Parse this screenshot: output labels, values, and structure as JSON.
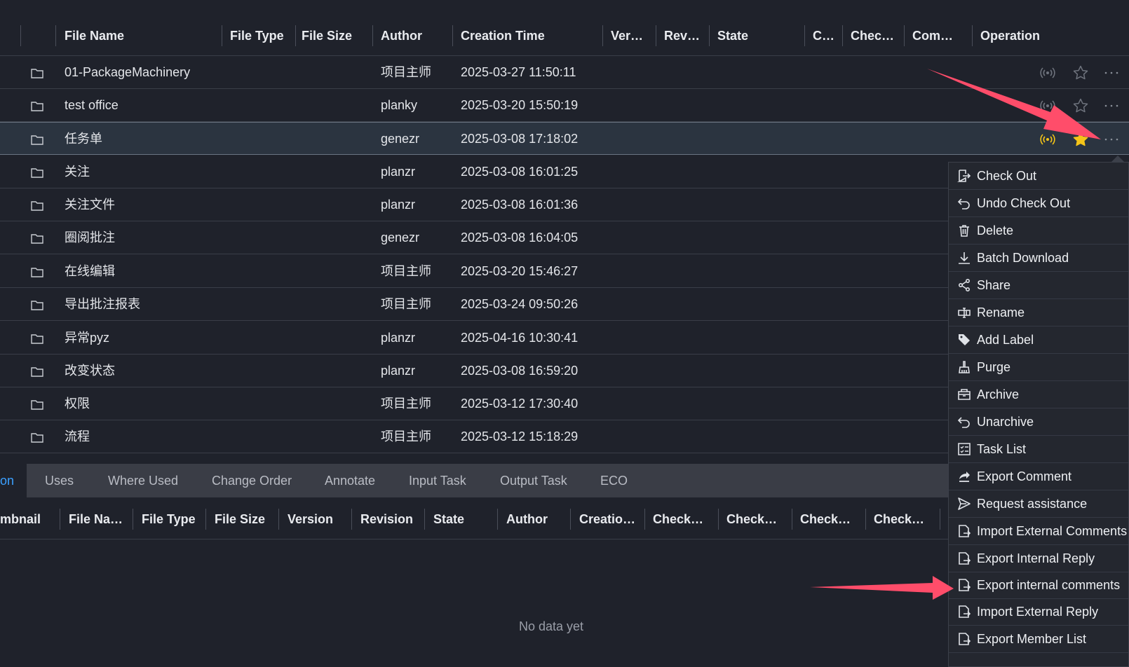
{
  "file_table": {
    "columns": [
      "File Name",
      "File Type",
      "File Size",
      "Author",
      "Creation Time",
      "Ver…",
      "Rev…",
      "State",
      "C…",
      "Chec…",
      "Com…",
      "Operation"
    ],
    "rows": [
      {
        "name": "01-PackageMachinery",
        "author": "项目主师",
        "created": "2025-03-27 11:50:11"
      },
      {
        "name": "test office",
        "author": "planky",
        "created": "2025-03-20 15:50:19"
      },
      {
        "name": "任务单",
        "author": "genezr",
        "created": "2025-03-08 17:18:02"
      },
      {
        "name": "关注",
        "author": "planzr",
        "created": "2025-03-08 16:01:25"
      },
      {
        "name": "关注文件",
        "author": "planzr",
        "created": "2025-03-08 16:01:36"
      },
      {
        "name": "圈阅批注",
        "author": "genezr",
        "created": "2025-03-08 16:04:05"
      },
      {
        "name": "在线编辑",
        "author": "项目主师",
        "created": "2025-03-20 15:46:27"
      },
      {
        "name": "导出批注报表",
        "author": "项目主师",
        "created": "2025-03-24 09:50:26"
      },
      {
        "name": "异常pyz",
        "author": "planzr",
        "created": "2025-04-16 10:30:41"
      },
      {
        "name": "改变状态",
        "author": "planzr",
        "created": "2025-03-08 16:59:20"
      },
      {
        "name": "权限",
        "author": "项目主师",
        "created": "2025-03-12 17:30:40"
      },
      {
        "name": "流程",
        "author": "项目主师",
        "created": "2025-03-12 15:18:29"
      }
    ],
    "selected_row": "任务单",
    "operation_icons": [
      "broadcast-icon",
      "star-icon",
      "more-icon"
    ]
  },
  "bottom_panel": {
    "tabs": [
      "on",
      "Uses",
      "Where Used",
      "Change Order",
      "Annotate",
      "Input Task",
      "Output Task",
      "ECO"
    ],
    "active_tab": "on",
    "columns": [
      "mbnail",
      "File Na…",
      "File Type",
      "File Size",
      "Version",
      "Revision",
      "State",
      "Author",
      "Creatio…",
      "Check…",
      "Check…",
      "Check…",
      "Check…"
    ],
    "empty_text": "No data yet"
  },
  "context_menu": {
    "items": [
      {
        "label": "Check Out",
        "icon": "check-out-icon"
      },
      {
        "label": "Undo Check Out",
        "icon": "undo-icon"
      },
      {
        "label": "Delete",
        "icon": "trash-icon"
      },
      {
        "label": "Batch Download",
        "icon": "download-icon"
      },
      {
        "label": "Share",
        "icon": "share-icon"
      },
      {
        "label": "Rename",
        "icon": "rename-icon"
      },
      {
        "label": "Add Label",
        "icon": "tag-icon"
      },
      {
        "label": "Purge",
        "icon": "broom-icon"
      },
      {
        "label": "Archive",
        "icon": "archive-icon"
      },
      {
        "label": "Unarchive",
        "icon": "unarchive-icon"
      },
      {
        "label": "Task List",
        "icon": "task-list-icon"
      },
      {
        "label": "Export Comment",
        "icon": "export-icon"
      },
      {
        "label": "Request assistance",
        "icon": "send-icon"
      },
      {
        "label": "Import External Comments",
        "icon": "file-export-icon"
      },
      {
        "label": "Export Internal Reply",
        "icon": "file-export-icon"
      },
      {
        "label": "Export internal comments",
        "icon": "file-export-icon"
      },
      {
        "label": "Import External Reply",
        "icon": "file-export-icon"
      },
      {
        "label": "Export Member List",
        "icon": "file-export-icon"
      }
    ]
  },
  "colors": {
    "background": "#1f222b",
    "selected_row": "#2b3440",
    "active_icon": "#f5c518",
    "accent": "#3ba0ff",
    "annotation_arrow": "#ff4d6a"
  }
}
